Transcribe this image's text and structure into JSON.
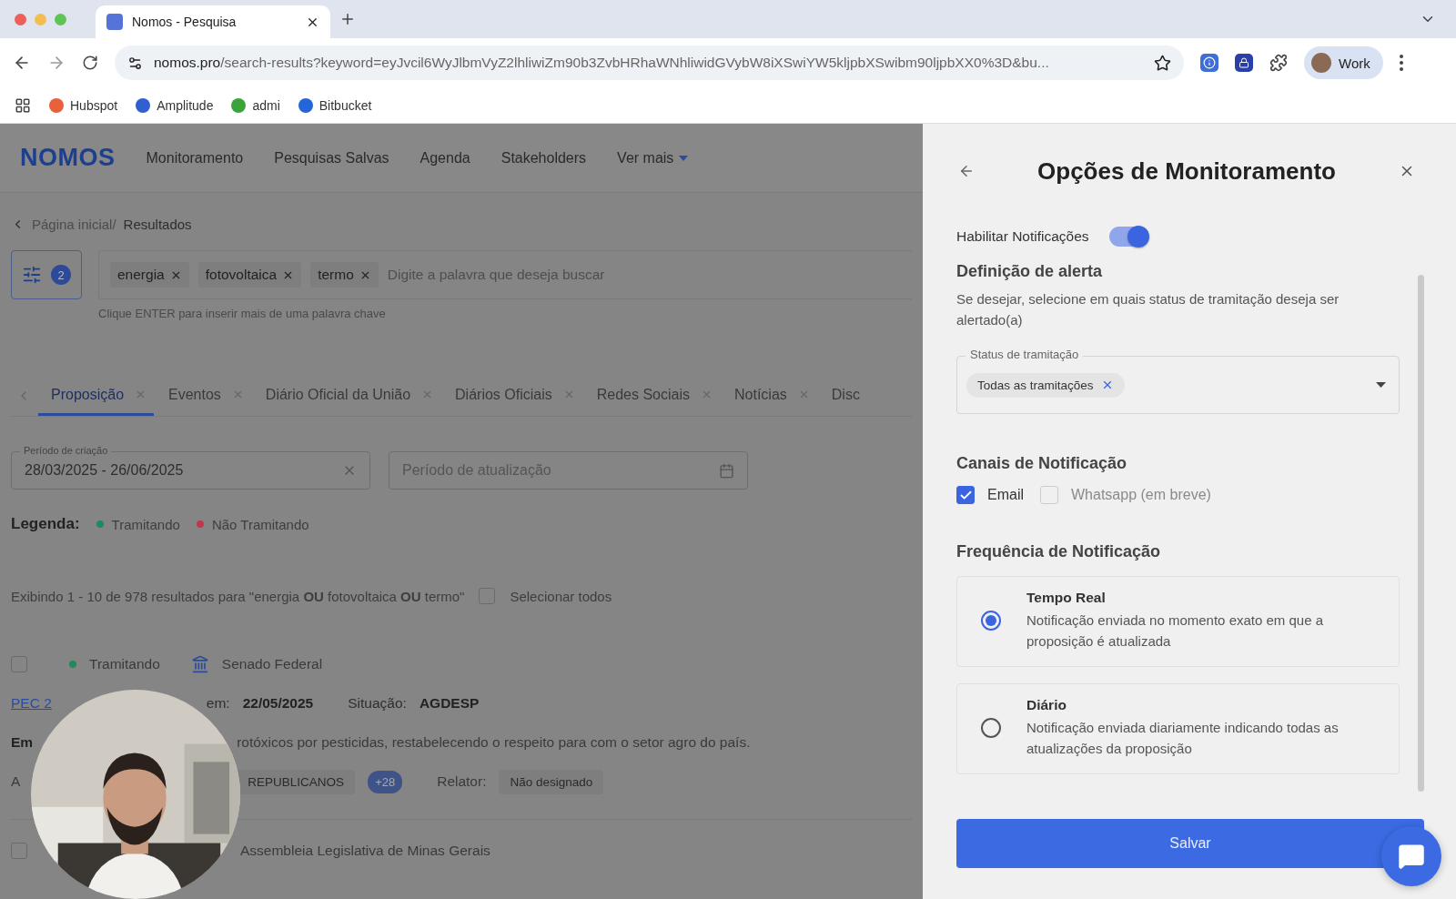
{
  "browser": {
    "tab": {
      "title": "Nomos - Pesquisa"
    },
    "url": {
      "host": "nomos.pro",
      "path": "/search-results?keyword=eyJvcil6WyJlbmVyZ2lhliwiZm90b3ZvbHRhaWNhliwidGVybW8iXSwiYW5kljpbXSwibm90ljpbXX0%3D&bu..."
    },
    "profile": "Work",
    "bookmarks": [
      {
        "label": "Hubspot",
        "color": "#e8603c"
      },
      {
        "label": "Amplitude",
        "color": "#2f5fd0"
      },
      {
        "label": "admi",
        "color": "#3aa33a"
      },
      {
        "label": "Bitbucket",
        "color": "#2466d8"
      }
    ]
  },
  "app": {
    "brand": "NOMOS",
    "nav": [
      "Monitoramento",
      "Pesquisas Salvas",
      "Agenda",
      "Stakeholders"
    ],
    "more": "Ver mais",
    "breadcrumb": {
      "parent": "Página inicial/",
      "current": "Resultados"
    },
    "filter_count": "2",
    "search": {
      "keywords": [
        "energia",
        "fotovoltaica",
        "termo"
      ],
      "placeholder": "Digite a palavra que deseja buscar",
      "hint": "Clique ENTER para inserir mais de uma palavra chave"
    },
    "tabs": [
      {
        "label": "Proposição",
        "selected": true
      },
      {
        "label": "Eventos",
        "selected": false
      },
      {
        "label": "Diário Oficial da União",
        "selected": false
      },
      {
        "label": "Diários Oficiais",
        "selected": false
      },
      {
        "label": "Redes Sociais",
        "selected": false
      },
      {
        "label": "Notícias",
        "selected": false
      },
      {
        "label": "Disc",
        "selected": false
      }
    ],
    "date_fields": [
      {
        "label": "Período de criação",
        "value": "28/03/2025 - 26/06/2025"
      },
      {
        "placeholder": "Período de atualização"
      }
    ],
    "legend": {
      "label": "Legenda:",
      "items": [
        {
          "label": "Tramitando",
          "color": "#1f8a5b"
        },
        {
          "label": "Não Tramitando",
          "color": "#c0394a"
        }
      ]
    },
    "summary": "Exibindo 1 - 10 de 978 resultados para  \"energia **OU** fotovoltaica **OU** termo\"",
    "select_all": {
      "label": "Selecionar todos",
      "checked": false
    },
    "results": [
      {
        "checked": false,
        "status": "Tramitando",
        "color": "#1f8a5b",
        "house": "Senado Federal",
        "id": "PEC 2",
        "date_label": "em:",
        "date": "22/05/2025",
        "situation_label": "Situação:",
        "situation": "AGDESP",
        "summary_start": "Em",
        "summary_end": "rotóxicos por pesticidas, restabelecendo o respeito para com o setor agro do país.",
        "authors_start": "A",
        "party": "REPUBLICANOS",
        "more": "+28",
        "rapporteur_label": "Relator:",
        "rapporteur": "Não designado"
      },
      {
        "checked": false,
        "house": "Assembleia Legislativa de Minas Gerais"
      }
    ]
  },
  "drawer": {
    "title": "Opções de Monitoramento",
    "notifications": {
      "label": "Habilitar Notificações",
      "on": true
    },
    "alert": {
      "heading": "Definição de alerta",
      "description": "Se desejar, selecione em quais status de tramitação deseja ser alertado(a)",
      "select_label": "Status de tramitação",
      "chips": [
        "Todas as tramitações"
      ]
    },
    "channels_heading": "Canais de Notificação",
    "channels": [
      {
        "label": "Email",
        "checked": true,
        "disabled": false
      },
      {
        "label": "Whatsapp (em breve)",
        "checked": false,
        "disabled": true
      }
    ],
    "frequency_heading": "Frequência de Notificação",
    "frequency": [
      {
        "title": "Tempo Real",
        "description": "Notificação enviada no momento exato em que a proposição é atualizada",
        "selected": true
      },
      {
        "title": "Diário",
        "description": "Notificação enviada diariamente indicando todas as atualizações da proposição",
        "selected": false
      }
    ],
    "save": "Salvar"
  }
}
